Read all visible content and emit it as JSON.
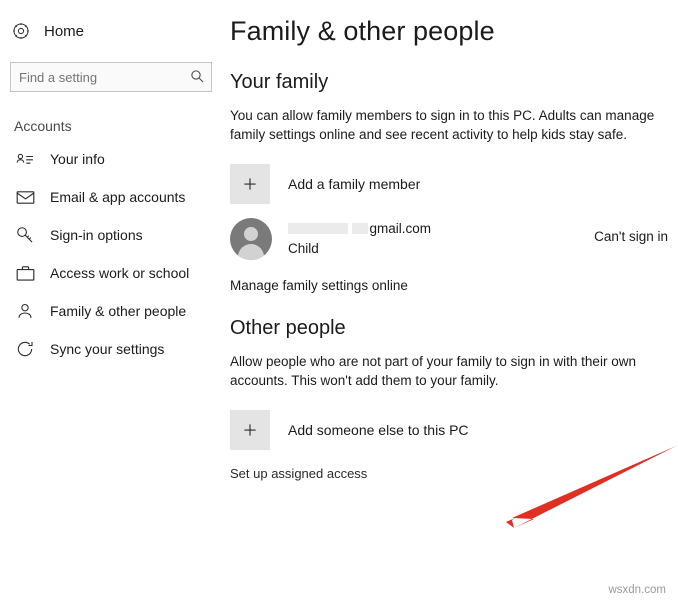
{
  "sidebar": {
    "home": {
      "label": "Home",
      "icon": "gear-icon"
    },
    "search": {
      "placeholder": "Find a setting",
      "value": "",
      "icon": "search-icon"
    },
    "section_label": "Accounts",
    "items": [
      {
        "label": "Your info",
        "icon": "person-badge-icon"
      },
      {
        "label": "Email & app accounts",
        "icon": "envelope-icon"
      },
      {
        "label": "Sign-in options",
        "icon": "key-icon"
      },
      {
        "label": "Access work or school",
        "icon": "briefcase-icon"
      },
      {
        "label": "Family & other people",
        "icon": "person-icon"
      },
      {
        "label": "Sync your settings",
        "icon": "sync-icon"
      }
    ]
  },
  "main": {
    "title": "Family & other people",
    "family": {
      "heading": "Your family",
      "description": "You can allow family members to sign in to this PC. Adults can manage family settings online and see recent activity to help kids stay safe.",
      "add_member_label": "Add a family member",
      "add_member_icon": "plus-icon",
      "account": {
        "name_redacted": "",
        "email": "gmail.com",
        "role": "Child",
        "status": "Can't sign in",
        "avatar_icon": "avatar-icon"
      },
      "manage_link": "Manage family settings online"
    },
    "other_people": {
      "heading": "Other people",
      "description": "Allow people who are not part of your family to sign in with their own accounts. This won't add them to your family.",
      "add_someone_label": "Add someone else to this PC",
      "add_someone_icon": "plus-icon",
      "assigned_access_link": "Set up assigned access"
    },
    "annotation": {
      "arrow_icon": "red-arrow-icon",
      "color": "#e03024"
    },
    "watermark": "wsxdn.com"
  }
}
